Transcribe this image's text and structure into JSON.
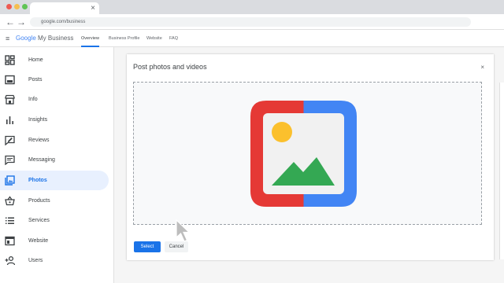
{
  "browser": {
    "tab_close": "×",
    "url": "google.com/business",
    "back_glyph": "←",
    "forward_glyph": "→"
  },
  "header": {
    "menu_glyph": "≡",
    "brand_google": "Google",
    "brand_product": " My Business",
    "nav": [
      {
        "label": "Overview",
        "active": true
      },
      {
        "label": "Business Profile",
        "active": false
      },
      {
        "label": "Website",
        "active": false
      },
      {
        "label": "FAQ",
        "active": false
      }
    ]
  },
  "sidebar": {
    "items": [
      {
        "label": "Home",
        "icon": "home-dashboard-icon"
      },
      {
        "label": "Posts",
        "icon": "posts-icon"
      },
      {
        "label": "Info",
        "icon": "storefront-icon"
      },
      {
        "label": "Insights",
        "icon": "bar-chart-icon"
      },
      {
        "label": "Reviews",
        "icon": "reviews-icon"
      },
      {
        "label": "Messaging",
        "icon": "message-icon"
      },
      {
        "label": "Photos",
        "icon": "photos-icon",
        "active": true
      },
      {
        "label": "Products",
        "icon": "basket-icon"
      },
      {
        "label": "Services",
        "icon": "list-icon"
      },
      {
        "label": "Website",
        "icon": "web-icon"
      },
      {
        "label": "Users",
        "icon": "add-user-icon"
      }
    ]
  },
  "dialog": {
    "title": "Post photos and videos",
    "close_glyph": "×",
    "select_label": "Select",
    "cancel_label": "Cancel"
  },
  "colors": {
    "accent": "#1a73e8",
    "active_bg": "#e8f0fe",
    "photo_red": "#e53935",
    "photo_blue": "#4285f4",
    "photo_yellow": "#fbc02d",
    "photo_green": "#34a853"
  }
}
